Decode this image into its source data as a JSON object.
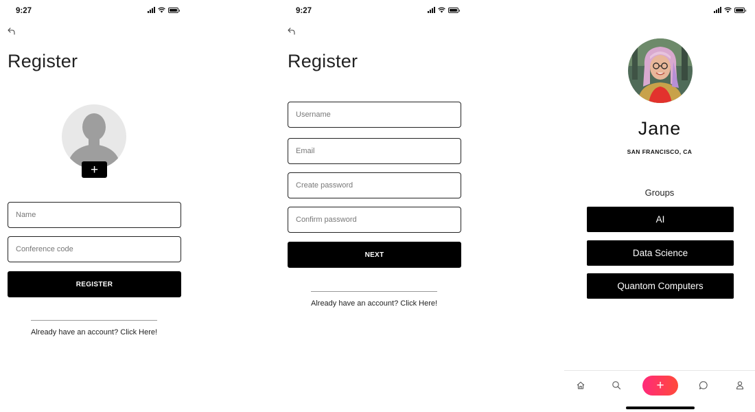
{
  "status_bar": {
    "time": "9:27"
  },
  "register_screen": {
    "title": "Register",
    "add_photo_label": "+",
    "name_placeholder": "Name",
    "conference_code_placeholder": "Conference code",
    "register_button": "REGISTER",
    "login_link": "Already have an account? Click Here!"
  },
  "register_details_screen": {
    "title": "Register",
    "username_placeholder": "Username",
    "email_placeholder": "Email",
    "create_password_placeholder": "Create password",
    "confirm_password_placeholder": "Confirm password",
    "next_button": "NEXT",
    "login_link": "Already have an account? Click Here!"
  },
  "profile_screen": {
    "name": "Jane",
    "location": "SAN FRANCISCO, CA",
    "groups_label": "Groups",
    "groups": [
      {
        "label": "AI"
      },
      {
        "label": "Data Science"
      },
      {
        "label": "Quantom Computers"
      }
    ],
    "tab_bar": {
      "items": [
        "home-icon",
        "search-icon",
        "add-icon",
        "chat-icon",
        "profile-icon"
      ],
      "fab_label": "+",
      "fab_colors": [
        "#ff2a7a",
        "#ff4a3a"
      ]
    }
  },
  "colors": {
    "primary": "#000000",
    "background": "#ffffff",
    "accent": "#ff2a7a"
  }
}
